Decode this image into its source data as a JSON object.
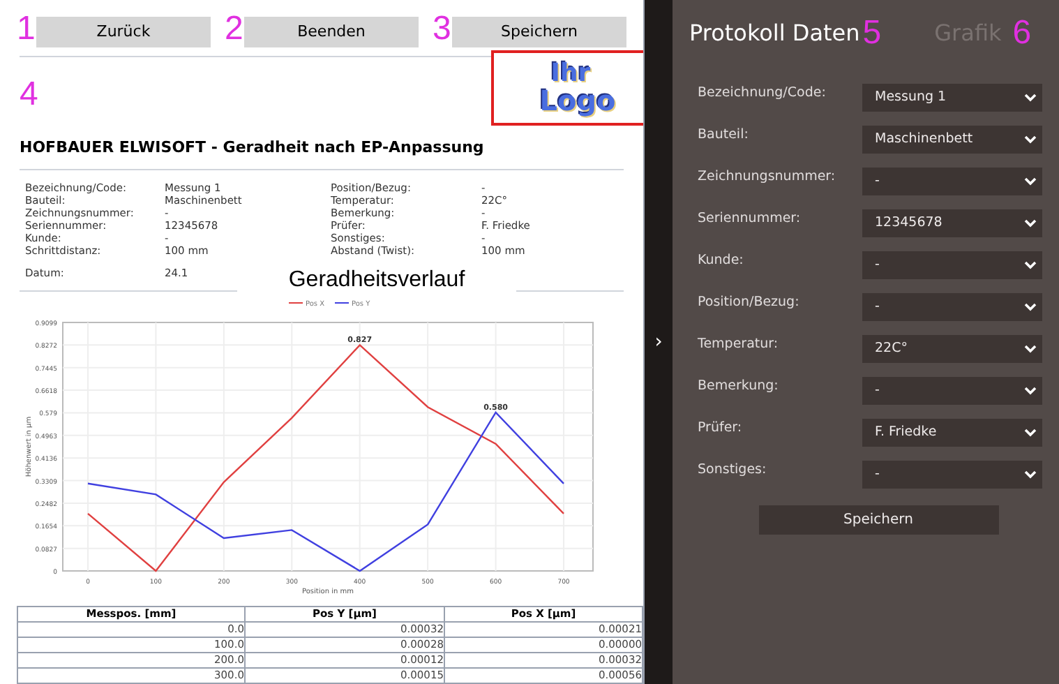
{
  "toolbar": [
    {
      "marker": "1",
      "label": "Zurück"
    },
    {
      "marker": "2",
      "label": "Beenden"
    },
    {
      "marker": "3",
      "label": "Speichern"
    }
  ],
  "report": {
    "marker": "4",
    "logo": [
      "Ihr",
      "Logo"
    ],
    "heading": "HOFBAUER ELWISOFT - Geradheit nach EP-Anpassung",
    "info_left": [
      {
        "label": "Bezeichnung/Code:",
        "value": "Messung 1"
      },
      {
        "label": "Bauteil:",
        "value": "Maschinenbett"
      },
      {
        "label": "Zeichnungsnummer:",
        "value": "-"
      },
      {
        "label": "Seriennummer:",
        "value": "12345678"
      },
      {
        "label": "Kunde:",
        "value": "-"
      },
      {
        "label": "Schrittdistanz:",
        "value": "100 mm"
      }
    ],
    "info_right": [
      {
        "label": "Position/Bezug:",
        "value": "-"
      },
      {
        "label": "Temperatur:",
        "value": "22C°"
      },
      {
        "label": "Bemerkung:",
        "value": "-"
      },
      {
        "label": "Prüfer:",
        "value": "F. Friedke"
      },
      {
        "label": "Sonstiges:",
        "value": "-"
      },
      {
        "label": "Abstand (Twist):",
        "value": "100 mm"
      }
    ],
    "date": {
      "label": "Datum:",
      "value": "24.1"
    },
    "chart": {
      "title": "Geradheitsverlauf",
      "chart_data": {
        "type": "line",
        "xlabel": "Position in mm",
        "ylabel": "Höhenwert in µm",
        "x": [
          0,
          100,
          200,
          300,
          400,
          500,
          600,
          700
        ],
        "series": [
          {
            "name": "Pos X",
            "color": "#e04040",
            "values": [
              0.21,
              0,
              0.325,
              0.56,
              0.827,
              0.6,
              0.465,
              0.21
            ]
          },
          {
            "name": "Pos Y",
            "color": "#4040e0",
            "values": [
              0.32,
              0.28,
              0.12,
              0.15,
              0,
              0.17,
              0.58,
              0.32
            ]
          }
        ],
        "grid": true,
        "legend": "top",
        "ylim": [
          0,
          0.9099
        ],
        "xlim": [
          0,
          700
        ],
        "xticks": [
          0,
          100,
          200,
          300,
          400,
          500,
          600,
          700
        ],
        "yticks": [
          0,
          0.0827,
          0.1654,
          0.2482,
          0.3309,
          0.4136,
          0.4963,
          0.579,
          0.6618,
          0.7445,
          0.8272,
          0.9099
        ],
        "annotations": [
          {
            "x": 400,
            "y": 0.827,
            "text": "0.827"
          },
          {
            "x": 600,
            "y": 0.58,
            "text": "0.580"
          }
        ]
      }
    },
    "table": {
      "columns": [
        "Messpos. [mm]",
        "Pos Y [µm]",
        "Pos X [µm]"
      ],
      "rows": [
        [
          "0.0",
          "0.00032",
          "0.00021"
        ],
        [
          "100.0",
          "0.00028",
          "0.00000"
        ],
        [
          "200.0",
          "0.00012",
          "0.00032"
        ],
        [
          "300.0",
          "0.00015",
          "0.00056"
        ]
      ]
    }
  },
  "collapse_handle": "›",
  "panel": {
    "tabs": [
      {
        "label": "Protokoll Daten",
        "marker": "5",
        "selected": true
      },
      {
        "label": "Grafik",
        "marker": "6",
        "selected": false
      }
    ],
    "fields": [
      {
        "label": "Bezeichnung/Code:",
        "value": "Messung 1"
      },
      {
        "label": "Bauteil:",
        "value": "Maschinenbett"
      },
      {
        "label": "Zeichnungsnummer:",
        "value": "-"
      },
      {
        "label": "Seriennummer:",
        "value": "12345678"
      },
      {
        "label": "Kunde:",
        "value": "-"
      },
      {
        "label": "Position/Bezug:",
        "value": "-"
      },
      {
        "label": "Temperatur:",
        "value": "22C°"
      },
      {
        "label": "Bemerkung:",
        "value": "-"
      },
      {
        "label": "Prüfer:",
        "value": "F. Friedke"
      },
      {
        "label": "Sonstiges:",
        "value": "-"
      }
    ],
    "save_button": "Speichern"
  }
}
